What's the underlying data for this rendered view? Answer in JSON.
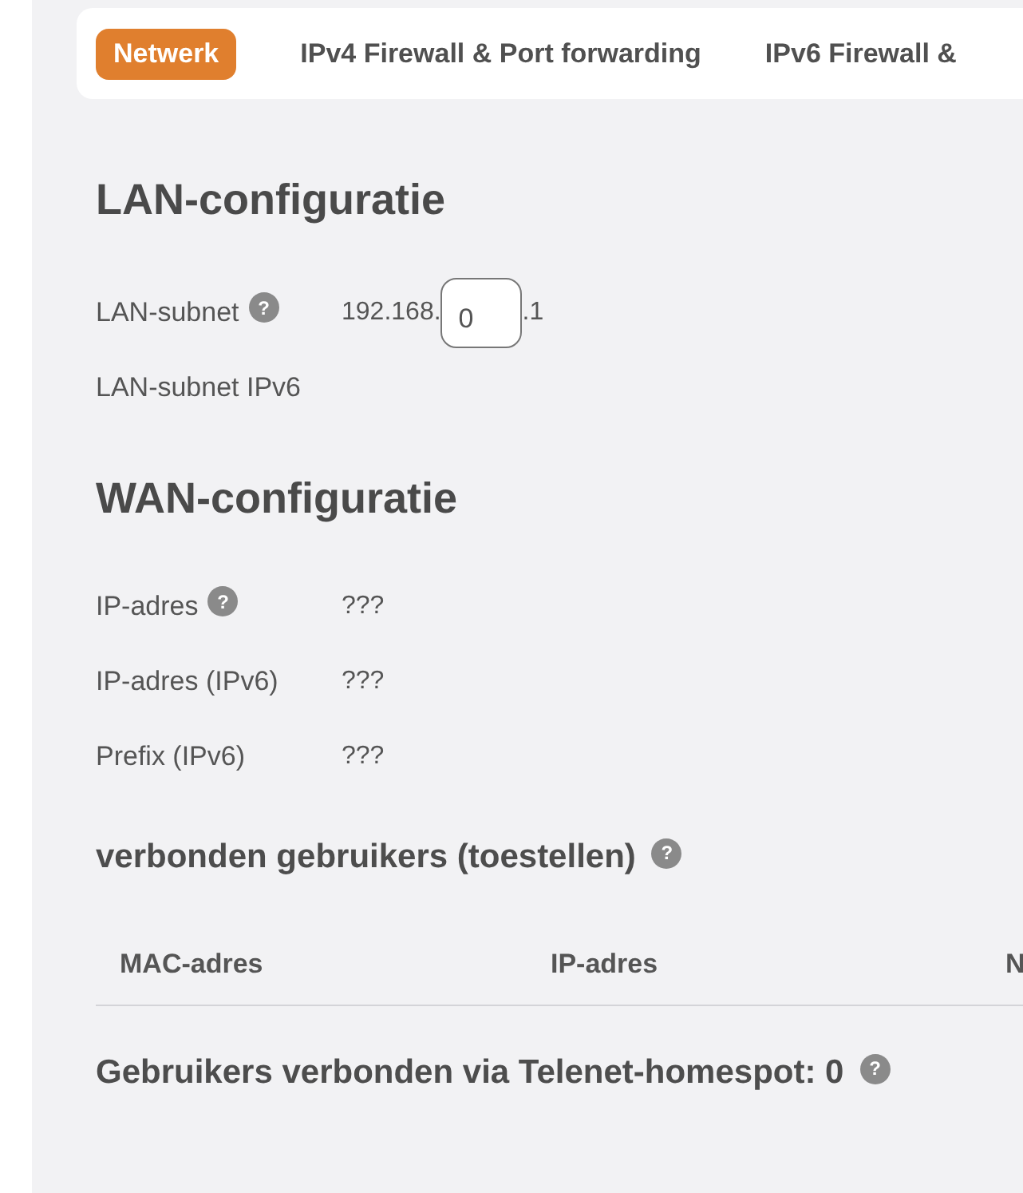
{
  "tabs": [
    {
      "label": "Netwerk",
      "selected": true
    },
    {
      "label": "IPv4 Firewall & Port forwarding",
      "selected": false
    },
    {
      "label": "IPv6 Firewall &",
      "selected": false
    }
  ],
  "lan": {
    "title": "LAN-configuratie",
    "rows": [
      {
        "kind": "ip",
        "label": "LAN-subnet",
        "help": "?",
        "prefix": "192.168.",
        "value": "0",
        "suffix": ".1"
      },
      {
        "label": "LAN-subnet IPv6"
      }
    ]
  },
  "wan": {
    "title": "WAN-configuratie",
    "rows": [
      {
        "kind": "text",
        "label": "IP-adres",
        "help": "?",
        "value": "???"
      },
      {
        "kind": "text",
        "label": "IP-adres (IPv6)",
        "value": "???"
      },
      {
        "kind": "text",
        "label": "Prefix (IPv6)",
        "value": "???"
      }
    ]
  },
  "users": {
    "title": "verbonden gebruikers (toestellen)",
    "help": "?",
    "columns": [
      "MAC-adres",
      "IP-adres",
      "N"
    ]
  },
  "homespot": {
    "title": "Gebruikers verbonden via Telenet-homespot: 0",
    "help": "?"
  }
}
